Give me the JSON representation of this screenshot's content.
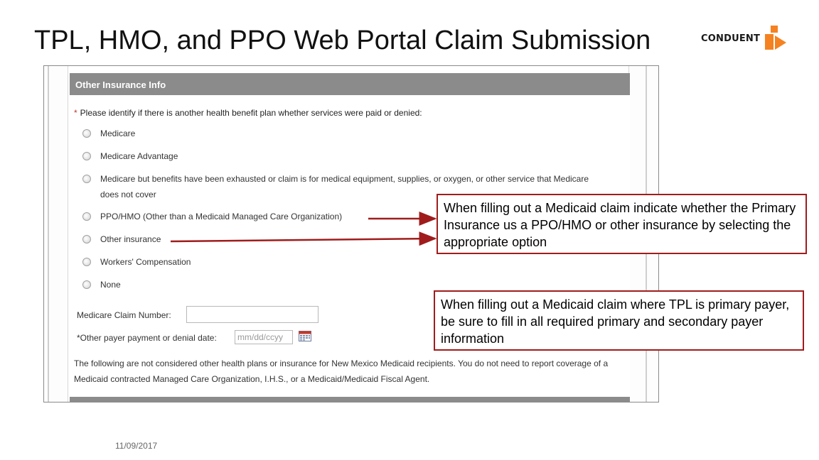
{
  "slide": {
    "title": "TPL, HMO, and PPO Web Portal Claim Submission",
    "footer_date": "11/09/2017"
  },
  "logo": {
    "text": "CONDUENT",
    "icon": "conduent-logo-icon",
    "color": "#f58220"
  },
  "form": {
    "header": "Other Insurance Info",
    "question": "Please identify if there is another health benefit plan whether services were paid or denied:",
    "required_marker": "*",
    "options": [
      {
        "label": "Medicare"
      },
      {
        "label": "Medicare Advantage"
      },
      {
        "label": "Medicare but benefits have been exhausted or claim is for medical equipment, supplies, or oxygen, or other service that Medicare does not cover"
      },
      {
        "label": "PPO/HMO (Other than a Medicaid Managed Care Organization)"
      },
      {
        "label": "Other insurance"
      },
      {
        "label": "Workers' Compensation"
      },
      {
        "label": "None"
      }
    ],
    "medicare_claim_number_label": "Medicare Claim Number:",
    "medicare_claim_number_value": "",
    "payer_date_label": "*Other payer payment or denial date:",
    "payer_date_placeholder": "mm/dd/ccyy",
    "note": "The following are not considered other health plans or insurance for New Mexico Medicaid recipients. You do not need to report coverage of a Medicaid contracted Managed Care Organization, I.H.S., or a Medicaid/Medicaid Fiscal Agent."
  },
  "callouts": [
    {
      "text": "When filling out a Medicaid claim indicate whether the Primary Insurance us a PPO/HMO or other insurance by selecting the appropriate option"
    },
    {
      "text": "When filling out a Medicaid claim where TPL is primary payer, be sure to fill in all required primary and secondary payer information"
    }
  ],
  "colors": {
    "header_gray": "#8b8b8b",
    "callout_border": "#a01c1c",
    "arrow": "#a01c1c",
    "required": "#c0392b"
  }
}
